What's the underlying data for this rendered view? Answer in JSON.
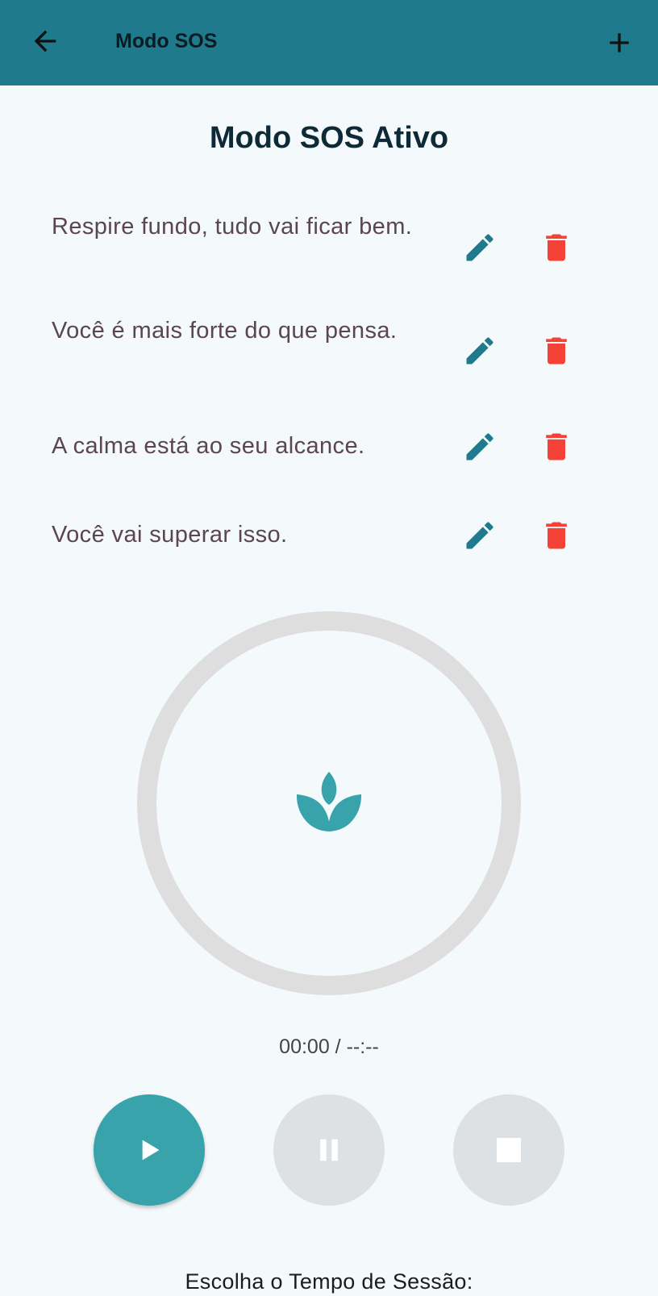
{
  "app_bar": {
    "title": "Modo SOS",
    "back_icon": "arrow-left-icon",
    "add_icon": "plus-icon"
  },
  "heading": "Modo SOS Ativo",
  "messages": [
    {
      "text": "Respire fundo, tudo vai ficar bem."
    },
    {
      "text": "Você é mais forte do que pensa."
    },
    {
      "text": "A calma está ao seu alcance."
    },
    {
      "text": "Você vai superar isso."
    }
  ],
  "message_actions": {
    "edit_icon": "pencil-icon",
    "delete_icon": "trash-icon"
  },
  "player": {
    "center_icon": "lotus-icon",
    "time_display": "00:00 / --:--",
    "controls": [
      {
        "name": "play",
        "icon": "play-icon",
        "active": true
      },
      {
        "name": "pause",
        "icon": "pause-icon",
        "active": false
      },
      {
        "name": "stop",
        "icon": "stop-icon",
        "active": false
      }
    ]
  },
  "session": {
    "label": "Escolha o Tempo de Sessão:"
  },
  "colors": {
    "primary": "#1e7a8c",
    "accent": "#38a3aa",
    "delete": "#f44336",
    "background": "#f4f9fb",
    "ring": "#dedede",
    "disabled_button": "#dde1e3"
  }
}
